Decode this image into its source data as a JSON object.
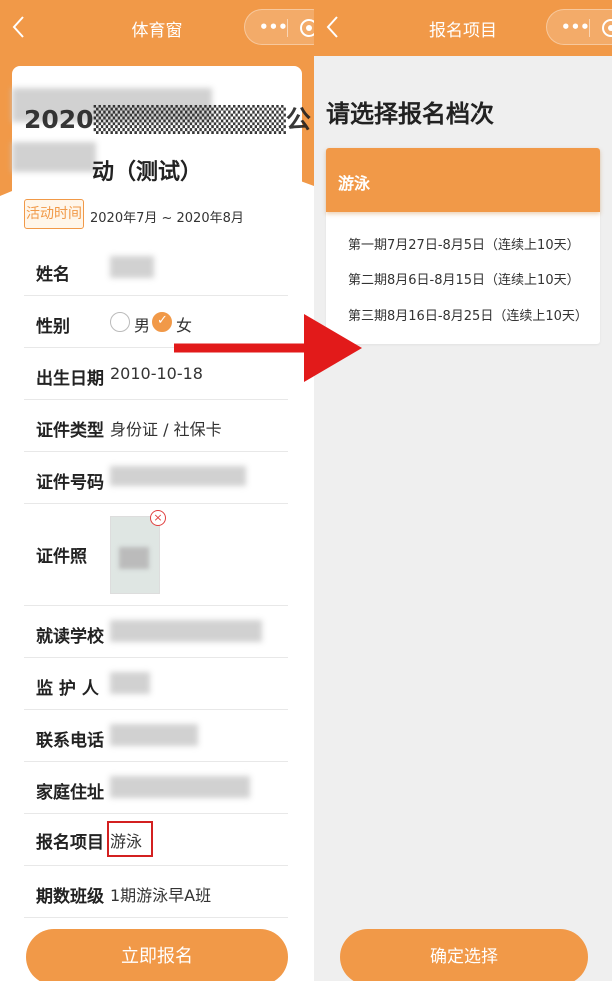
{
  "left": {
    "nav_title": "体育窗",
    "capsule_dots": "•••",
    "event_title_line1": "2020▒▒▒▒▒▒▒▒▒▒公",
    "event_title_line2": "动（测试）",
    "activity_time_label": "活动时间",
    "activity_time_value": "2020年7月 ~ 2020年8月",
    "fields": {
      "name_label": "姓名",
      "gender_label": "性别",
      "gender_male": "男",
      "gender_female": "女",
      "birthdate_label": "出生日期",
      "birthdate_value": "2010-10-18",
      "id_type_label": "证件类型",
      "id_type_value": "身份证 / 社保卡",
      "id_number_label": "证件号码",
      "id_photo_label": "证件照",
      "school_label": "就读学校",
      "guardian_label": "监 护 人",
      "phone_label": "联系电话",
      "address_label": "家庭住址",
      "project_label": "报名项目",
      "project_value": "游泳",
      "class_label": "期数班级",
      "class_value": "1期游泳早A班"
    },
    "delete_icon_glyph": "×",
    "submit_label": "立即报名"
  },
  "right": {
    "nav_title": "报名项目",
    "capsule_dots": "•••",
    "heading": "请选择报名档次",
    "category": "游泳",
    "options": [
      "第一期7月27日-8月5日（连续上10天）",
      "第二期8月6日-8月15日（连续上10天）",
      "第三期8月16日-8月25日（连续上10天）"
    ],
    "confirm_label": "确定选择"
  },
  "colors": {
    "accent": "#f19948",
    "annotation_red": "#e21a1a"
  },
  "gender_selected": "女"
}
